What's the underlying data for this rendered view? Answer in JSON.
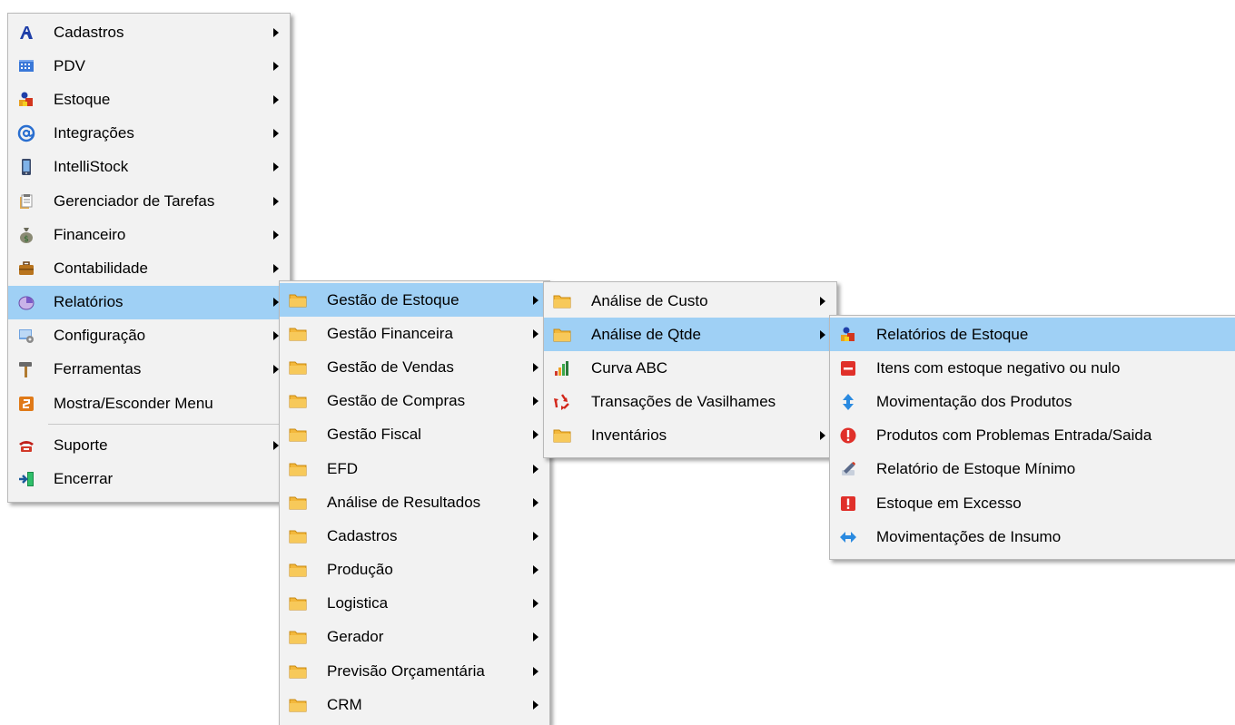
{
  "main_menu": {
    "items": [
      {
        "label": "Cadastros",
        "icon": "cadastros-icon",
        "submenu": true
      },
      {
        "label": "PDV",
        "icon": "cash-register-icon",
        "submenu": true
      },
      {
        "label": "Estoque",
        "icon": "stock-icon",
        "submenu": true
      },
      {
        "label": "Integrações",
        "icon": "at-sign-icon",
        "submenu": true
      },
      {
        "label": "IntelliStock",
        "icon": "mobile-device-icon",
        "submenu": true
      },
      {
        "label": "Gerenciador de Tarefas",
        "icon": "clipboard-icon",
        "submenu": true
      },
      {
        "label": "Financeiro",
        "icon": "money-bag-icon",
        "submenu": true
      },
      {
        "label": "Contabilidade",
        "icon": "briefcase-icon",
        "submenu": true
      },
      {
        "label": "Relatórios",
        "icon": "reports-icon",
        "submenu": true,
        "selected": true
      },
      {
        "label": "Configuração",
        "icon": "settings-icon",
        "submenu": true
      },
      {
        "label": "Ferramentas",
        "icon": "hammer-icon",
        "submenu": true
      },
      {
        "label": "Mostra/Esconder Menu",
        "icon": "toggle-menu-icon",
        "submenu": false
      },
      {
        "label": "Suporte",
        "icon": "telephone-icon",
        "submenu": true
      },
      {
        "label": "Encerrar",
        "icon": "exit-icon",
        "submenu": false
      }
    ]
  },
  "reports_menu": {
    "items": [
      {
        "label": "Gestão de Estoque",
        "selected": true
      },
      {
        "label": "Gestão Financeira"
      },
      {
        "label": "Gestão de Vendas"
      },
      {
        "label": "Gestão de Compras"
      },
      {
        "label": "Gestão Fiscal"
      },
      {
        "label": "EFD"
      },
      {
        "label": "Análise de Resultados"
      },
      {
        "label": "Cadastros"
      },
      {
        "label": "Produção"
      },
      {
        "label": "Logistica"
      },
      {
        "label": "Gerador"
      },
      {
        "label": "Previsão Orçamentária"
      },
      {
        "label": "CRM"
      }
    ]
  },
  "stock_menu": {
    "items": [
      {
        "label": "Análise de Custo",
        "icon": "folder-icon",
        "submenu": true
      },
      {
        "label": "Análise de Qtde",
        "icon": "folder-icon",
        "submenu": true,
        "selected": true
      },
      {
        "label": "Curva ABC",
        "icon": "bar-chart-icon",
        "submenu": false
      },
      {
        "label": "Transações de Vasilhames",
        "icon": "recycle-icon",
        "submenu": false
      },
      {
        "label": "Inventários",
        "icon": "folder-icon",
        "submenu": true
      }
    ]
  },
  "qty_menu": {
    "items": [
      {
        "label": "Relatórios de Estoque",
        "icon": "stock-icon",
        "selected": true
      },
      {
        "label": "Itens com estoque negativo ou nulo",
        "icon": "minus-box-icon"
      },
      {
        "label": "Movimentação dos Produtos",
        "icon": "up-down-arrow-icon"
      },
      {
        "label": "Produtos com Problemas Entrada/Saida",
        "icon": "alert-circle-icon"
      },
      {
        "label": "Relatório de Estoque Mínimo",
        "icon": "pen-tool-icon"
      },
      {
        "label": "Estoque em Excesso",
        "icon": "exclamation-box-icon"
      },
      {
        "label": "Movimentações de Insumo",
        "icon": "left-right-arrow-icon"
      }
    ]
  },
  "colors": {
    "selection": "#9fd0f5",
    "menu_background": "#f2f2f2",
    "folder": "#f3b83c"
  }
}
